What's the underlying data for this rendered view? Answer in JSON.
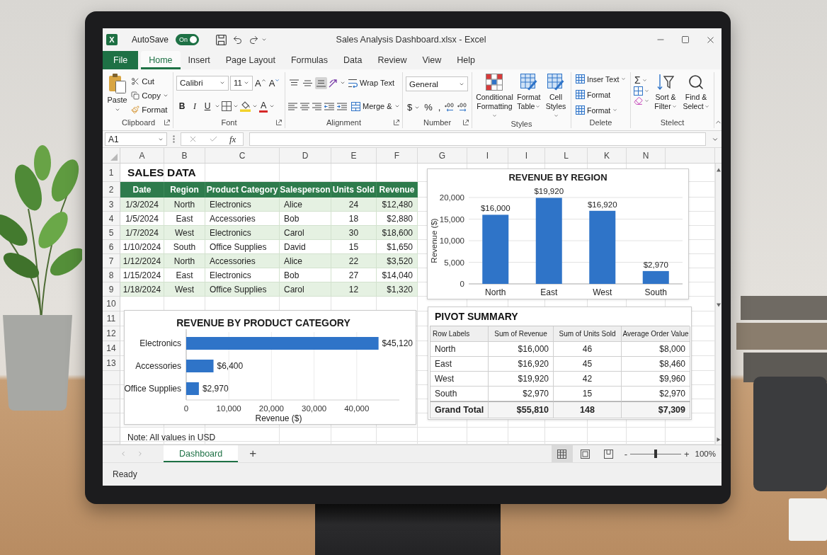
{
  "title_bar": {
    "logo": "X",
    "autosave_label": "AutoSave",
    "autosave": {
      "label": "On",
      "on": true
    },
    "title": "Sales Analysis Dashboard.xlsx - Excel"
  },
  "ribbon_tabs": [
    {
      "label": "File",
      "kind": "file",
      "selected": false
    },
    {
      "label": "Home",
      "kind": "tab",
      "selected": true
    },
    {
      "label": "Insert",
      "kind": "tab",
      "selected": false
    },
    {
      "label": "Page Layout",
      "kind": "tab",
      "selected": false
    },
    {
      "label": "Formulas",
      "kind": "tab",
      "selected": false
    },
    {
      "label": "Data",
      "kind": "tab",
      "selected": false
    },
    {
      "label": "Review",
      "kind": "tab",
      "selected": false
    },
    {
      "label": "View",
      "kind": "tab",
      "selected": false
    },
    {
      "label": "Help",
      "kind": "tab",
      "selected": false
    }
  ],
  "ribbon": {
    "clipboard": {
      "label": "Clipboard",
      "paste": "Paste",
      "commands": [
        "Cut",
        "Copy",
        "Format"
      ]
    },
    "font": {
      "label": "Font",
      "font_name": "Calibri",
      "font_size": "11",
      "size_buttons": [
        "A",
        "A"
      ],
      "style_buttons": [
        "B",
        "I",
        "U"
      ],
      "font_color": "A"
    },
    "alignment": {
      "label": "Alignment",
      "vertical_align": [
        {
          "selected": false
        },
        {
          "selected": false
        },
        {
          "selected": true
        }
      ],
      "wrap_text": "Wrap Text",
      "merge": "Merge &"
    },
    "number": {
      "label": "Number",
      "format": "General",
      "symbols": [
        "$",
        "%",
        ","
      ]
    },
    "styles": {
      "label": "Styles",
      "commands": [
        "Conditional Formatting",
        "Format Table",
        "Cell Styles"
      ]
    },
    "cells": {
      "label": "Delete",
      "commands": [
        {
          "label": "Inser Text",
          "dropdown": true
        },
        {
          "label": "Format",
          "dropdown": false
        },
        {
          "label": "Format",
          "dropdown": true
        }
      ]
    },
    "editing": {
      "label": "Stelect",
      "sigma": "Σ",
      "commands": [
        "Sort & Filter",
        "Find & Select"
      ]
    }
  },
  "formula_bar": {
    "name_box": "A1",
    "function_label": "fx"
  },
  "sheet": {
    "columns": [
      "A",
      "B",
      "C",
      "D",
      "E",
      "F",
      "G",
      "I",
      "I",
      "L",
      "K",
      "N"
    ],
    "rows": [
      "1",
      "2",
      "3",
      "4",
      "5",
      "6",
      "7",
      "8",
      "9",
      "10",
      "11",
      "12",
      "14",
      "13"
    ]
  },
  "sales_table": {
    "title": "SALES DATA",
    "columns": [
      "Date",
      "Region",
      "Product Category",
      "Salesperson",
      "Units Sold",
      "Revenue"
    ],
    "rows": [
      [
        "1/3/2024",
        "North",
        "Electronics",
        "Alice",
        "24",
        "$12,480"
      ],
      [
        "1/5/2024",
        "East",
        "Accessories",
        "Bob",
        "18",
        "$2,880"
      ],
      [
        "1/7/2024",
        "West",
        "Electronics",
        "Carol",
        "30",
        "$18,600"
      ],
      [
        "1/10/2024",
        "South",
        "Office Supplies",
        "David",
        "15",
        "$1,650"
      ],
      [
        "1/12/2024",
        "North",
        "Accessories",
        "Alice",
        "22",
        "$3,520"
      ],
      [
        "1/15/2024",
        "East",
        "Electronics",
        "Bob",
        "27",
        "$14,040"
      ],
      [
        "1/18/2024",
        "West",
        "Office Supplies",
        "Carol",
        "12",
        "$1,320"
      ]
    ]
  },
  "region_chart": {
    "chart_data": {
      "type": "bar",
      "title": "REVENUE BY REGION",
      "ylabel": "Revenue ($)",
      "categories": [
        "North",
        "East",
        "West",
        "South"
      ],
      "series": [
        {
          "color": "#2f74c8",
          "values": [
            16000,
            19920,
            16920,
            2970
          ]
        }
      ],
      "ylim": [
        0,
        20000
      ],
      "yticks": [
        {
          "value": 0,
          "label": "0"
        },
        {
          "value": 5000,
          "label": "5,000"
        },
        {
          "value": 10000,
          "label": "10,000"
        },
        {
          "value": 15000,
          "label": "15,000"
        },
        {
          "value": 20000,
          "label": "20,000"
        }
      ],
      "grid": true,
      "value_labels": [
        "$16,000",
        "$19,920",
        "$16,920",
        "$2,970"
      ]
    }
  },
  "category_chart": {
    "chart_data": {
      "type": "bar",
      "orientation": "horizontal",
      "title": "REVENUE BY PRODUCT CATEGORY",
      "xlabel": "Revenue ($)",
      "categories": [
        "Electronics",
        "Accessories",
        "Office Supplies"
      ],
      "series": [
        {
          "color": "#2f74c8",
          "values": [
            45120,
            6400,
            2970
          ]
        }
      ],
      "xlim": [
        0,
        50000
      ],
      "xticks": [
        {
          "value": 0,
          "label": "0"
        },
        {
          "value": 10000,
          "label": "10,000"
        },
        {
          "value": 20000,
          "label": "20,000"
        },
        {
          "value": 30000,
          "label": "30,000"
        },
        {
          "value": 40000,
          "label": "40,000"
        }
      ],
      "grid": true,
      "value_labels": [
        "$45,120",
        "$6,400",
        "$2,970"
      ]
    }
  },
  "note": "Note: All values in USD",
  "pivot_summary": {
    "title": "PIVOT SUMMARY",
    "columns": [
      "Row Labels",
      "Sum of Revenue",
      "Sum of Units Sold",
      "Average Order Value"
    ],
    "rows": [
      [
        "North",
        "$16,000",
        "46",
        "$8,000"
      ],
      [
        "East",
        "$16,920",
        "45",
        "$8,460"
      ],
      [
        "West",
        "$19,920",
        "42",
        "$9,960"
      ],
      [
        "South",
        "$2,970",
        "15",
        "$2,970"
      ]
    ],
    "grand_total": [
      "Grand Total",
      "$55,810",
      "148",
      "$7,309"
    ]
  },
  "sheet_tabs": [
    {
      "label": "Dashboard",
      "selected": true
    }
  ],
  "add_sheet": "+",
  "view_buttons": [
    {
      "selected": true
    },
    {
      "selected": false
    },
    {
      "selected": false
    }
  ],
  "zoom": {
    "minus": "-",
    "plus": "+",
    "level": 0.5,
    "reading": "100%"
  },
  "status_bar": {
    "status": "Ready"
  }
}
